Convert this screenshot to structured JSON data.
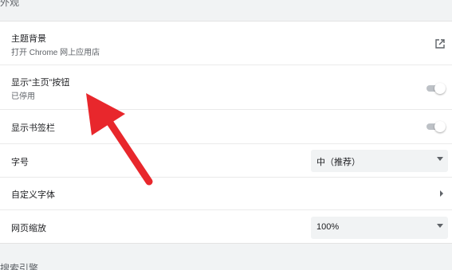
{
  "section": {
    "title": "外观"
  },
  "rows": {
    "theme": {
      "label": "主题背景",
      "sub": "打开 Chrome 网上应用店",
      "icon": "external-link-icon"
    },
    "home_button": {
      "label": "显示“主页”按钮",
      "sub": "已停用",
      "enabled": false
    },
    "bookmarks_bar": {
      "label": "显示书签栏",
      "enabled": false
    },
    "font_size": {
      "label": "字号",
      "value": "中（推荐）"
    },
    "custom_fonts": {
      "label": "自定义字体",
      "icon": "chevron-right-icon"
    },
    "page_zoom": {
      "label": "网页缩放",
      "value": "100%"
    }
  },
  "next_section": {
    "title": "搜索引擎"
  },
  "colors": {
    "annotation_arrow": "#e8272c",
    "toggle_off": "#bdc1c6"
  }
}
